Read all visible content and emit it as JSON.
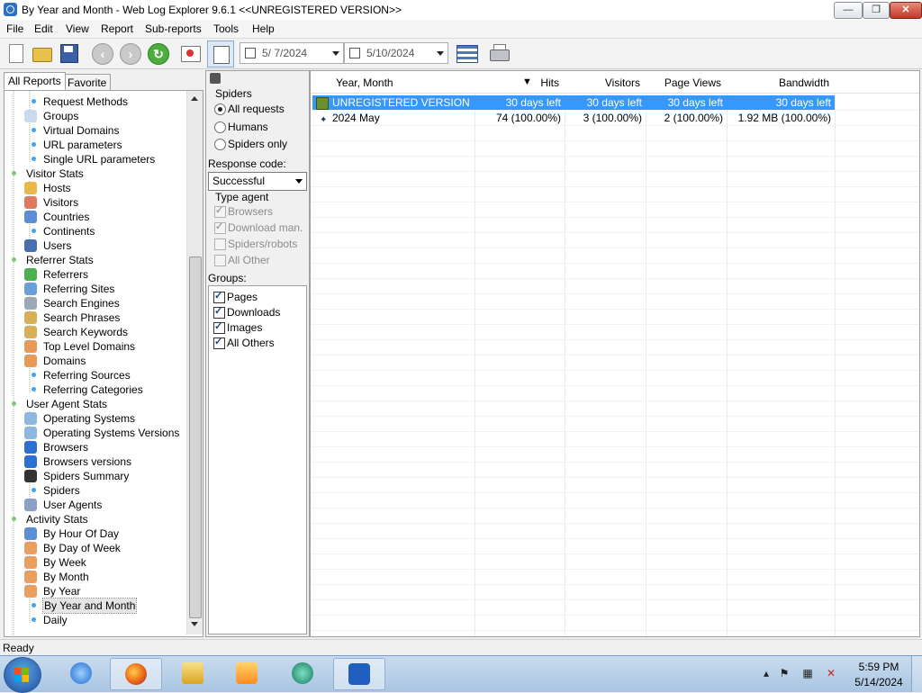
{
  "window": {
    "title": "By Year and Month - Web Log Explorer 9.6.1 <<UNREGISTERED VERSION>>",
    "minimize": "—",
    "maximize": "❐",
    "close": "✕"
  },
  "menu": [
    "File",
    "Edit",
    "View",
    "Report",
    "Sub-reports",
    "Tools",
    "Help"
  ],
  "toolbar": {
    "date_from": "5/ 7/2024",
    "date_to": "5/10/2024",
    "buttons": [
      "new-report-icon",
      "open-folder-icon",
      "save-disk-icon",
      "back-arrow-icon",
      "forward-arrow-icon",
      "refresh-icon",
      "report-view-icon",
      "filter-panel-icon",
      "columns-icon",
      "printer-icon"
    ]
  },
  "left_tabs": {
    "all": "All Reports",
    "favorite": "Favorite"
  },
  "tree": [
    {
      "label": "Request Methods",
      "icon": "dot"
    },
    {
      "label": "Groups",
      "icon": "grid"
    },
    {
      "label": "Virtual Domains",
      "icon": "dot"
    },
    {
      "label": "URL parameters",
      "icon": "dot"
    },
    {
      "label": "Single URL parameters",
      "icon": "dot"
    },
    {
      "label": "Visitor Stats",
      "icon": "section"
    },
    {
      "label": "Hosts",
      "icon": "hosts"
    },
    {
      "label": "Visitors",
      "icon": "visitor"
    },
    {
      "label": "Countries",
      "icon": "globe"
    },
    {
      "label": "Continents",
      "icon": "dot"
    },
    {
      "label": "Users",
      "icon": "user"
    },
    {
      "label": "Referrer Stats",
      "icon": "section"
    },
    {
      "label": "Referrers",
      "icon": "globe-green"
    },
    {
      "label": "Referring Sites",
      "icon": "site"
    },
    {
      "label": "Search Engines",
      "icon": "engine"
    },
    {
      "label": "Search Phrases",
      "icon": "magnifier"
    },
    {
      "label": "Search Keywords",
      "icon": "magnifier"
    },
    {
      "label": "Top Level Domains",
      "icon": "grid-color"
    },
    {
      "label": "Domains",
      "icon": "grid-color"
    },
    {
      "label": "Referring Sources",
      "icon": "dot"
    },
    {
      "label": "Referring Categories",
      "icon": "dot"
    },
    {
      "label": "User Agent Stats",
      "icon": "section"
    },
    {
      "label": "Operating Systems",
      "icon": "disc"
    },
    {
      "label": "Operating Systems Versions",
      "icon": "disc"
    },
    {
      "label": "Browsers",
      "icon": "ie"
    },
    {
      "label": "Browsers versions",
      "icon": "ie"
    },
    {
      "label": "Spiders Summary",
      "icon": "spider"
    },
    {
      "label": "Spiders",
      "icon": "dot"
    },
    {
      "label": "User Agents",
      "icon": "agent"
    },
    {
      "label": "Activity Stats",
      "icon": "section"
    },
    {
      "label": "By Hour Of Day",
      "icon": "clock"
    },
    {
      "label": "By Day of Week",
      "icon": "calendar"
    },
    {
      "label": "By Week",
      "icon": "calendar"
    },
    {
      "label": "By Month",
      "icon": "calendar"
    },
    {
      "label": "By Year",
      "icon": "calendar"
    },
    {
      "label": "By Year and Month",
      "icon": "dot",
      "selected": true
    },
    {
      "label": "Daily",
      "icon": "dot"
    }
  ],
  "filter": {
    "spiders_label": "Spiders",
    "radio_all": "All requests",
    "radio_humans": "Humans",
    "radio_spiders": "Spiders only",
    "response_label": "Response code:",
    "response_value": "Successful",
    "type_agent_label": "Type agent",
    "agent_browsers": "Browsers",
    "agent_download": "Download man.",
    "agent_spiders": "Spiders/robots",
    "agent_other": "All Other",
    "groups_label": "Groups:",
    "group_pages": "Pages",
    "group_downloads": "Downloads",
    "group_images": "Images",
    "group_others": "All Others"
  },
  "grid": {
    "columns": [
      "Year, Month",
      "Hits",
      "Visitors",
      "Page Views",
      "Bandwidth"
    ],
    "rows": [
      {
        "name": "UNREGISTERED VERSION",
        "hits": "30 days left",
        "visitors": "30 days left",
        "views": "30 days left",
        "bandwidth": "30 days left"
      },
      {
        "name": "2024 May",
        "hits": "74 (100.00%)",
        "visitors": "3 (100.00%)",
        "views": "2 (100.00%)",
        "bandwidth": "1.92 MB (100.00%)"
      }
    ]
  },
  "status": "Ready",
  "taskbar": {
    "time": "5:59 PM",
    "date": "5/14/2024",
    "apps": [
      "internet-explorer-icon",
      "firefox-icon",
      "file-explorer-icon",
      "media-player-icon",
      "chat-app-icon",
      "web-log-explorer-icon"
    ]
  },
  "colors": {
    "selection": "#3399ff",
    "taskbar": "#a9c5e2"
  }
}
